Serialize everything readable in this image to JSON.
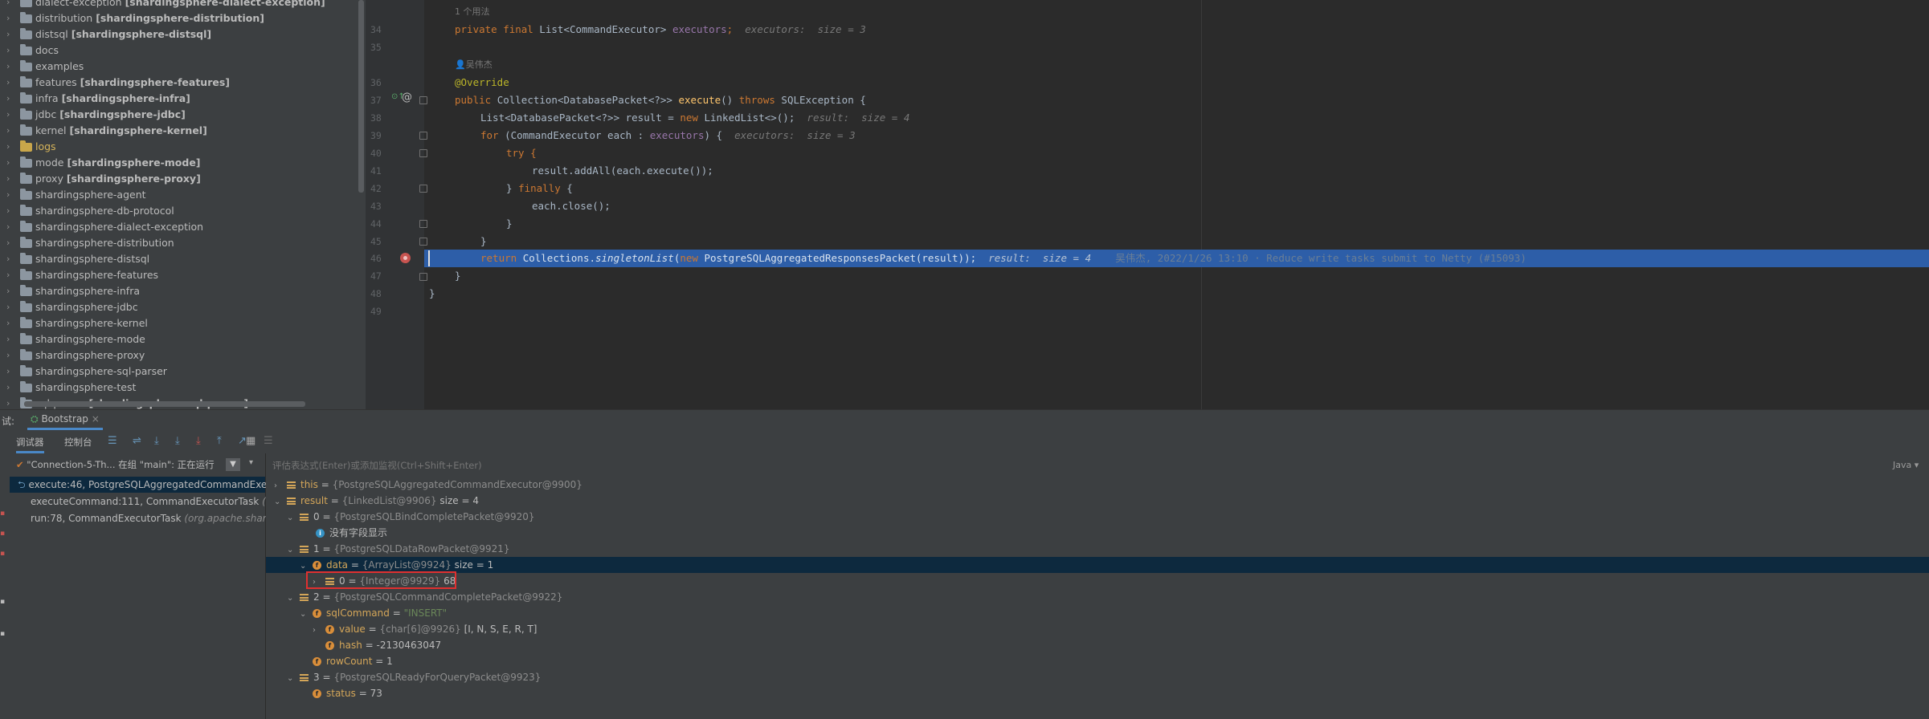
{
  "project_tree": {
    "items": [
      {
        "name": "dialect-exception",
        "module": "[shardingsphere-dialect-exception]",
        "excluded": false
      },
      {
        "name": "distribution",
        "module": "[shardingsphere-distribution]",
        "excluded": false
      },
      {
        "name": "distsql",
        "module": "[shardingsphere-distsql]",
        "excluded": false
      },
      {
        "name": "docs",
        "module": "",
        "excluded": false
      },
      {
        "name": "examples",
        "module": "",
        "excluded": false
      },
      {
        "name": "features",
        "module": "[shardingsphere-features]",
        "excluded": false
      },
      {
        "name": "infra",
        "module": "[shardingsphere-infra]",
        "excluded": false
      },
      {
        "name": "jdbc",
        "module": "[shardingsphere-jdbc]",
        "excluded": false
      },
      {
        "name": "kernel",
        "module": "[shardingsphere-kernel]",
        "excluded": false
      },
      {
        "name": "logs",
        "module": "",
        "excluded": true
      },
      {
        "name": "mode",
        "module": "[shardingsphere-mode]",
        "excluded": false
      },
      {
        "name": "proxy",
        "module": "[shardingsphere-proxy]",
        "excluded": false
      },
      {
        "name": "shardingsphere-agent",
        "module": "",
        "excluded": false
      },
      {
        "name": "shardingsphere-db-protocol",
        "module": "",
        "excluded": false
      },
      {
        "name": "shardingsphere-dialect-exception",
        "module": "",
        "excluded": false
      },
      {
        "name": "shardingsphere-distribution",
        "module": "",
        "excluded": false
      },
      {
        "name": "shardingsphere-distsql",
        "module": "",
        "excluded": false
      },
      {
        "name": "shardingsphere-features",
        "module": "",
        "excluded": false
      },
      {
        "name": "shardingsphere-infra",
        "module": "",
        "excluded": false
      },
      {
        "name": "shardingsphere-jdbc",
        "module": "",
        "excluded": false
      },
      {
        "name": "shardingsphere-kernel",
        "module": "",
        "excluded": false
      },
      {
        "name": "shardingsphere-mode",
        "module": "",
        "excluded": false
      },
      {
        "name": "shardingsphere-proxy",
        "module": "",
        "excluded": false
      },
      {
        "name": "shardingsphere-sql-parser",
        "module": "",
        "excluded": false
      },
      {
        "name": "shardingsphere-test",
        "module": "",
        "excluded": false
      },
      {
        "name": "sql-parser",
        "module": "[shardingsphere-sql-parser]",
        "excluded": false
      }
    ]
  },
  "editor": {
    "usage_hint": "1 个用法",
    "author_hint": "吴伟杰",
    "line_numbers": [
      "34",
      "35",
      "36",
      "37",
      "38",
      "39",
      "40",
      "41",
      "42",
      "43",
      "44",
      "45",
      "46",
      "47",
      "48",
      "49"
    ],
    "code": {
      "l34_a": "private final ",
      "l34_b": "List<CommandExecutor> ",
      "l34_c": "executors",
      "l34_d": ";",
      "l34_hint": "executors:  size = 3",
      "l36": "@Override",
      "l37_a": "public ",
      "l37_b": "Collection<DatabasePacket<?>> ",
      "l37_c": "execute",
      "l37_d": "() ",
      "l37_e": "throws ",
      "l37_f": "SQLException {",
      "l38_a": "List<DatabasePacket<?>> result = ",
      "l38_b": "new ",
      "l38_c": "LinkedList<>();",
      "l38_hint": "result:  size = 4",
      "l39_a": "for ",
      "l39_b": "(CommandExecutor each : ",
      "l39_c": "executors",
      "l39_d": ") {",
      "l39_hint": "executors:  size = 3",
      "l40": "try {",
      "l41": "result.addAll(each.execute());",
      "l42_a": "} ",
      "l42_b": "finally ",
      "l42_c": "{",
      "l43": "each.close();",
      "l44": "}",
      "l45": "}",
      "l46_a": "return ",
      "l46_b": "Collections.",
      "l46_c": "singletonList",
      "l46_d": "(",
      "l46_e": "new ",
      "l46_f": "PostgreSQLAggregatedResponsesPacket(result));",
      "l46_hint": "result:  size = 4",
      "l46_blame": "吴伟杰, 2022/1/26 13:10 · Reduce write tasks submit to Netty (#15093)",
      "l47": "}",
      "l48": "}"
    }
  },
  "debug": {
    "window_label": "试:",
    "run_config": "Bootstrap",
    "tab_debugger": "调试器",
    "tab_console": "控制台",
    "thread": "\"Connection-5-Th... 在组 \"main\": 正在运行",
    "eval_placeholder": "评估表达式(Enter)或添加监视(Ctrl+Shift+Enter)",
    "language": "Java",
    "frames": [
      {
        "method": "execute:46, PostgreSQLAggregatedCommandExec",
        "pkg": ""
      },
      {
        "method": "executeCommand:111, CommandExecutorTask ",
        "pkg": "(or"
      },
      {
        "method": "run:78, CommandExecutorTask ",
        "pkg": "(org.apache.shard"
      }
    ],
    "vars": {
      "this_name": "this",
      "this_eq": " = ",
      "this_type": "{PostgreSQLAggregatedCommandExecutor@9900}",
      "result_name": "result",
      "result_type": "{LinkedList@9906}",
      "result_size": "  size = 4",
      "r0_name": "0",
      "r0_type": "{PostgreSQLBindCompletePacket@9920}",
      "r0_child": "没有字段显示",
      "r1_name": "1",
      "r1_type": "{PostgreSQLDataRowPacket@9921}",
      "data_name": "data",
      "data_type": "{ArrayList@9924}",
      "data_size": "  size = 1",
      "d0_name": "0",
      "d0_type": "{Integer@9929}",
      "d0_val": " 68",
      "r2_name": "2",
      "r2_type": "{PostgreSQLCommandCompletePacket@9922}",
      "sql_name": "sqlCommand",
      "sql_val": "\"INSERT\"",
      "value_name": "value",
      "value_type": "{char[6]@9926}",
      "value_val": " [I, N, S, E, R, T]",
      "hash_name": "hash",
      "hash_val": "-2130463047",
      "rc_name": "rowCount",
      "rc_val": "1",
      "r3_name": "3",
      "r3_type": "{PostgreSQLReadyForQueryPacket@9923}",
      "status_name": "status",
      "status_val": "73"
    }
  }
}
